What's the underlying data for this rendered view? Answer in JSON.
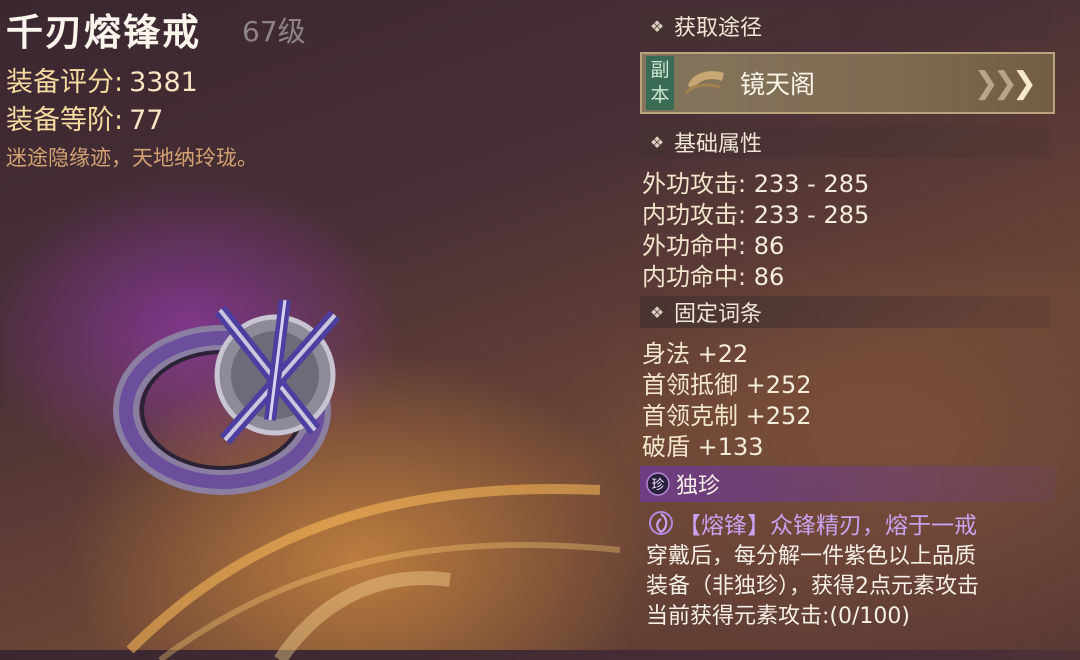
{
  "item": {
    "name": "千刃熔锋戒",
    "level": "67级",
    "score_label": "装备评分:",
    "score": "3381",
    "tier_label": "装备等阶:",
    "tier": "77",
    "flavor": "迷途隐缘迹，天地纳玲珑。"
  },
  "source": {
    "header": "获取途径",
    "badge_top": "副",
    "badge_bottom": "本",
    "label": "镜天阁"
  },
  "basic": {
    "header": "基础属性",
    "rows": [
      {
        "key": "外功攻击:",
        "value": "233 - 285"
      },
      {
        "key": "内功攻击:",
        "value": "233 - 285"
      },
      {
        "key": "外功命中:",
        "value": "86"
      },
      {
        "key": "内功命中:",
        "value": "86"
      }
    ]
  },
  "fixed": {
    "header": "固定词条",
    "rows": [
      {
        "key": "身法",
        "value": "+22"
      },
      {
        "key": "首领抵御",
        "value": "+252"
      },
      {
        "key": "首领克制",
        "value": "+252"
      },
      {
        "key": "破盾",
        "value": "+133"
      }
    ]
  },
  "unique": {
    "icon_char": "珍",
    "title": "独珍",
    "skill": "【熔锋】众锋精刃，熔于一戒",
    "desc": [
      "穿戴后，每分解一件紫色以上品质",
      "装备（非独珍），获得2点元素攻击",
      "当前获得元素攻击:(0/100)"
    ]
  },
  "colors": {
    "accent_gold": "#f4d9a0",
    "unique_purple": "#c9a2ef",
    "badge_green": "#3a6b55"
  }
}
